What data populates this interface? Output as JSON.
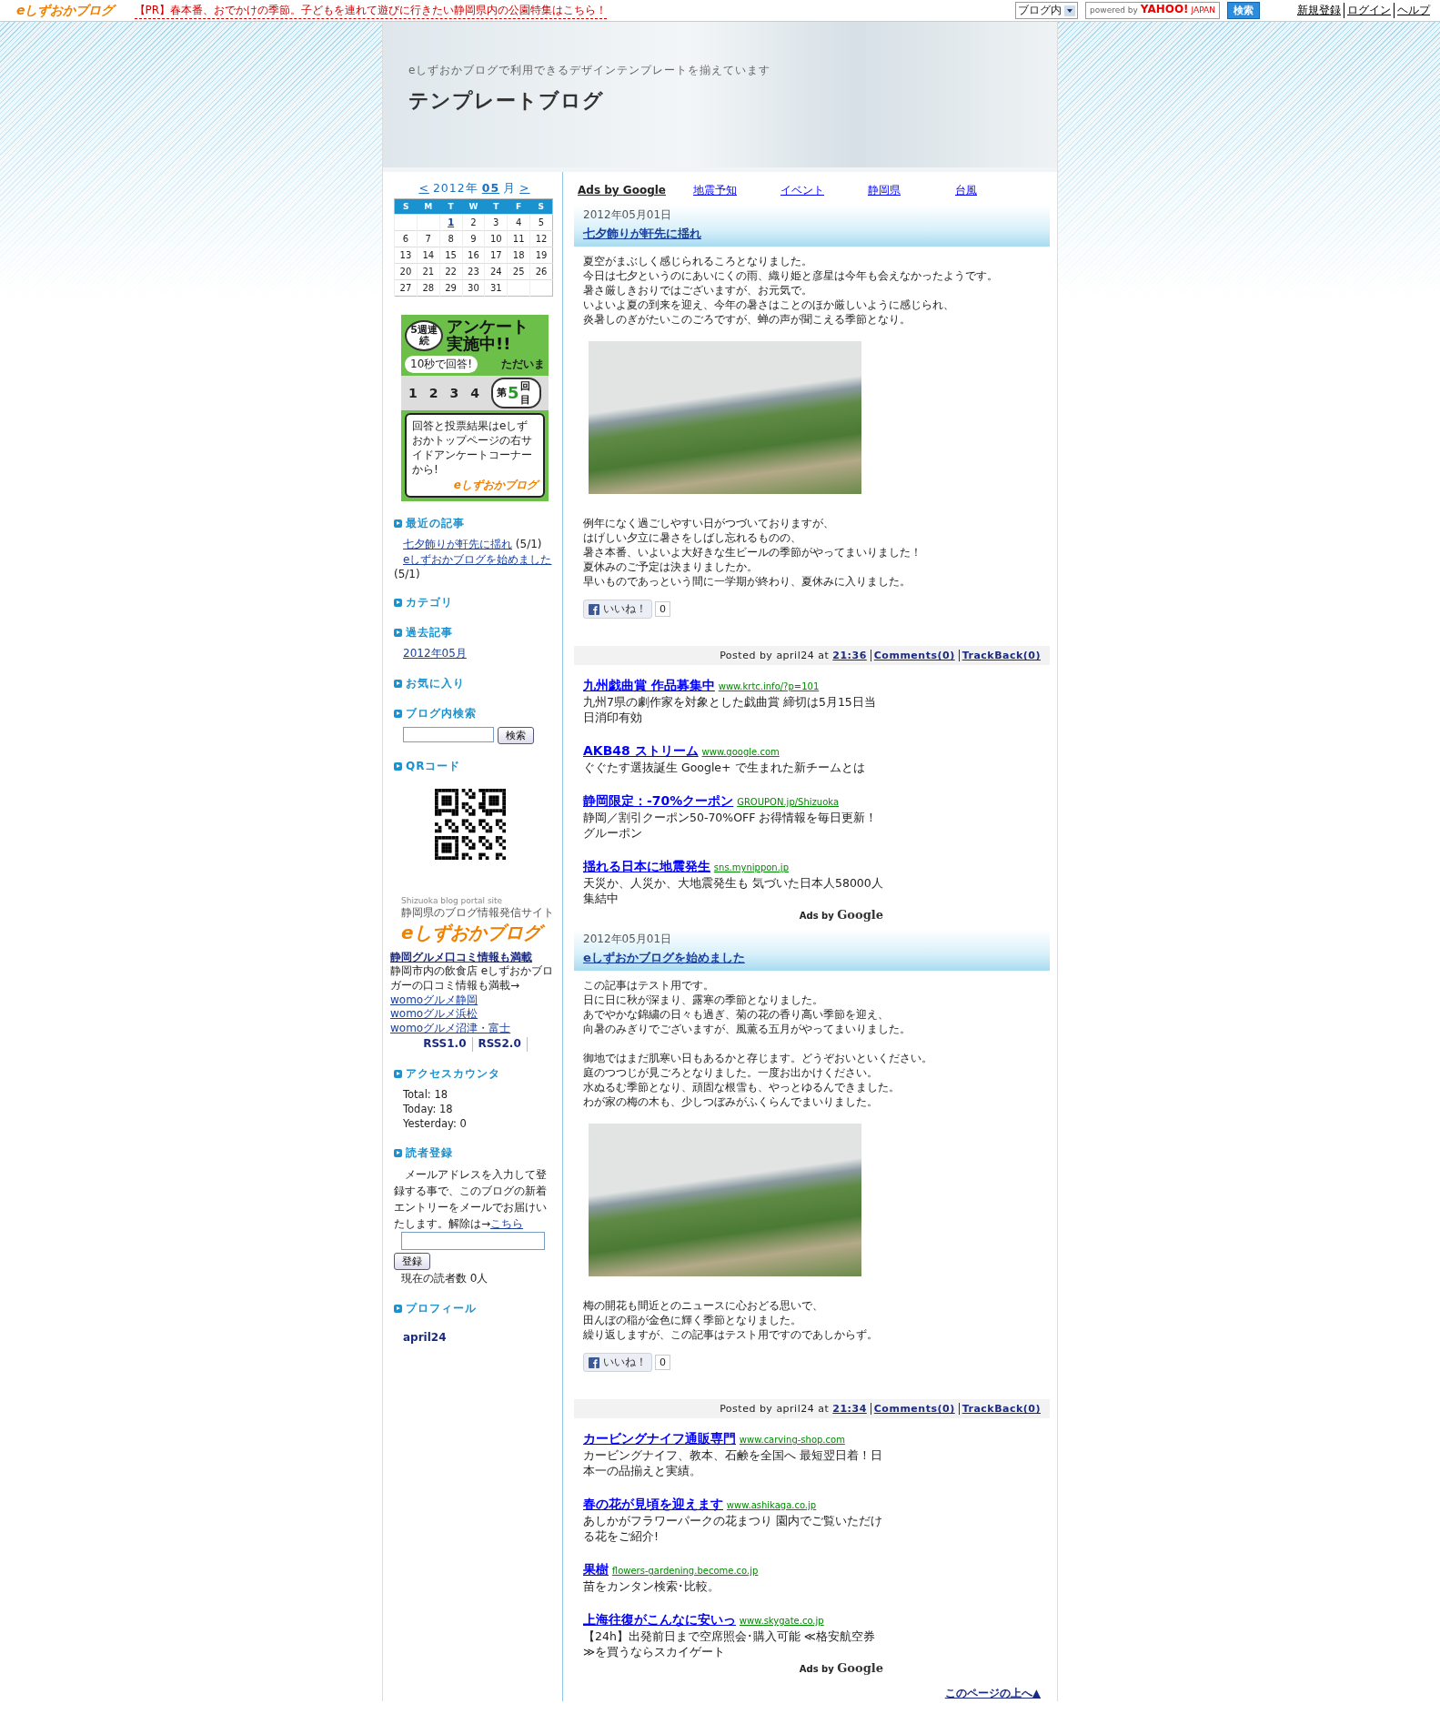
{
  "top_bar": {
    "logo": "eしずおかブログ",
    "pr_text": "【PR】春本番、おでかけの季節。子どもを連れて遊びに行きたい静岡県内の公園特集はこちら！",
    "search_scope": "ブログ内",
    "powered_by": "powered by",
    "yahoo": "YAHOO!",
    "yahoo_sub": "JAPAN",
    "search_button": "検索",
    "links": [
      "新規登録",
      "ログイン",
      "ヘルプ"
    ]
  },
  "header": {
    "tagline": "eしずおかブログで利用できるデザインテンプレートを揃えています",
    "title": "テンプレートブログ"
  },
  "calendar": {
    "prev": "<",
    "year": "2012年",
    "month": "05",
    "month_suffix": "月",
    "next": ">",
    "weekdays": [
      "S",
      "M",
      "T",
      "W",
      "T",
      "F",
      "S"
    ],
    "weeks": [
      [
        {
          "kind": "blank"
        },
        {
          "kind": "blank"
        },
        {
          "kind": "day",
          "day": "1",
          "linked": true
        },
        {
          "kind": "day",
          "day": "2",
          "linked": false
        },
        {
          "kind": "day",
          "day": "3",
          "linked": false
        },
        {
          "kind": "day",
          "day": "4",
          "linked": false
        },
        {
          "kind": "day",
          "day": "5",
          "linked": false
        }
      ],
      [
        {
          "kind": "day",
          "day": "6",
          "linked": false
        },
        {
          "kind": "day",
          "day": "7",
          "linked": false
        },
        {
          "kind": "day",
          "day": "8",
          "linked": false
        },
        {
          "kind": "day",
          "day": "9",
          "linked": false
        },
        {
          "kind": "day",
          "day": "10",
          "linked": false
        },
        {
          "kind": "day",
          "day": "11",
          "linked": false
        },
        {
          "kind": "day",
          "day": "12",
          "linked": false
        }
      ],
      [
        {
          "kind": "day",
          "day": "13",
          "linked": false
        },
        {
          "kind": "day",
          "day": "14",
          "linked": false
        },
        {
          "kind": "day",
          "day": "15",
          "linked": false
        },
        {
          "kind": "day",
          "day": "16",
          "linked": false
        },
        {
          "kind": "day",
          "day": "17",
          "linked": false
        },
        {
          "kind": "day",
          "day": "18",
          "linked": false
        },
        {
          "kind": "day",
          "day": "19",
          "linked": false
        }
      ],
      [
        {
          "kind": "day",
          "day": "20",
          "linked": false
        },
        {
          "kind": "day",
          "day": "21",
          "linked": false
        },
        {
          "kind": "day",
          "day": "22",
          "linked": false
        },
        {
          "kind": "day",
          "day": "23",
          "linked": false
        },
        {
          "kind": "day",
          "day": "24",
          "linked": false
        },
        {
          "kind": "day",
          "day": "25",
          "linked": false
        },
        {
          "kind": "day",
          "day": "26",
          "linked": false
        }
      ],
      [
        {
          "kind": "day",
          "day": "27",
          "linked": false
        },
        {
          "kind": "day",
          "day": "28",
          "linked": false
        },
        {
          "kind": "day",
          "day": "29",
          "linked": false
        },
        {
          "kind": "day",
          "day": "30",
          "linked": false
        },
        {
          "kind": "day",
          "day": "31",
          "linked": false
        },
        {
          "kind": "blank"
        },
        {
          "kind": "blank"
        }
      ]
    ]
  },
  "survey_banner": {
    "weeks_badge": "5週連続",
    "headline": "アンケート実施中!!",
    "pill": "10秒で回答!",
    "now": "ただいま",
    "numbers": [
      "1",
      "2",
      "3",
      "4"
    ],
    "ordinal_prefix": "第",
    "current": "5",
    "ordinal_suffix": "回目",
    "message": "回答と投票結果はeしずおかトップページの右サイドアンケートコーナーから!",
    "logo": "eしずおかブログ"
  },
  "recent": {
    "title": "最近の記事",
    "items": [
      {
        "label": "七夕飾りが軒先に揺れ",
        "date": "(5/1)"
      },
      {
        "label": "eしずおかブログを始めました",
        "date": "(5/1)"
      }
    ]
  },
  "category": {
    "title": "カテゴリ"
  },
  "archive": {
    "title": "過去記事",
    "items": [
      "2012年05月"
    ]
  },
  "favorites": {
    "title": "お気に入り"
  },
  "blog_search": {
    "title": "ブログ内検索",
    "button": "検索"
  },
  "qr": {
    "title": "QRコード"
  },
  "portal": {
    "caption": "Shizuoka blog portal site",
    "subtitle": "静岡県のブログ情報発信サイト",
    "logo": "eしずおかブログ",
    "gourmet_title": "静岡グルメ口コミ情報も満載",
    "gourmet_text": "静岡市内の飲食店 eしずおかブロガーの口コミ情報も満載→",
    "links": [
      "womoグルメ静岡",
      "womoグルメ浜松",
      "womoグルメ沼津・富士"
    ],
    "rss": [
      "RSS1.0",
      "RSS2.0"
    ]
  },
  "counter": {
    "title": "アクセスカウンタ",
    "lines": [
      "Total: 18",
      "Today: 18",
      "Yesterday: 0"
    ]
  },
  "subscribe": {
    "title": "読者登録",
    "text": "メールアドレスを入力して登録する事で、このブログの新着エントリーをメールでお届けいたします。解除は→",
    "link": "こちら",
    "button": "登録",
    "count": "現在の読者数 0人"
  },
  "profile": {
    "title": "プロフィール",
    "name": "april24"
  },
  "ad_links": {
    "label": "Ads by Google",
    "links": [
      "地震予知",
      "イベント",
      "静岡県",
      "台風"
    ]
  },
  "posts": [
    {
      "date": "2012年05月01日",
      "title": "七夕飾りが軒先に揺れ",
      "body": [
        {
          "kind": "text",
          "lines": [
            "夏空がまぶしく感じられるころとなりました。",
            "今日は七夕というのにあいにくの雨、織り姫と彦星は今年も会えなかったようです。",
            "暑さ厳しきおりではございますが、お元気で。",
            "いよいよ夏の到来を迎え、今年の暑さはことのほか厳しいように感じられ、",
            "炎暑しのぎがたいこのごろですが、蝉の声が聞こえる季節となり。"
          ]
        },
        {
          "kind": "photo"
        },
        {
          "kind": "text",
          "lines": [
            "例年になく過ごしやすい日がつづいておりますが、",
            "はげしい夕立に暑さをしばし忘れるものの、",
            "暑さ本番、いよいよ大好きな生ビールの季節がやってまいりました！",
            "夏休みのご予定は決まりましたか。",
            "早いものであっという間に一学期が終わり、夏休みに入りました。"
          ]
        }
      ],
      "like": "いいね！",
      "like_count": "0",
      "posted_by": "Posted by april24 at",
      "time": "21:36",
      "comments": "Comments(0)",
      "trackback": "TrackBack(0)",
      "ads": [
        {
          "title": "九州戯曲賞 作品募集中",
          "url": "www.krtc.info/?p=101",
          "desc": "九州7県の劇作家を対象とした戯曲賞 締切は5月15日当日消印有効"
        },
        {
          "title": "AKB48 ストリーム",
          "url": "www.google.com",
          "desc": "ぐぐたす選抜誕生 Google+ で生まれた新チームとは"
        },
        {
          "title": "静岡限定：-70%クーポン",
          "url": "GROUPON.jp/Shizuoka",
          "desc": "静岡／割引クーポン50-70%OFF お得情報を毎日更新！グルーポン"
        },
        {
          "title": "揺れる日本に地震発生",
          "url": "sns.mynippon.jp",
          "desc": "天災か、人災か、大地震発生も 気づいた日本人58000人集結中"
        }
      ],
      "ads_label": "Ads by",
      "ads_brand": "Google"
    },
    {
      "date": "2012年05月01日",
      "title": "eしずおかブログを始めました",
      "body": [
        {
          "kind": "text",
          "lines": [
            "この記事はテスト用です。",
            "日に日に秋が深まり、露寒の季節となりました。",
            "あでやかな錦繍の日々も過ぎ、菊の花の香り高い季節を迎え、",
            "向暑のみぎりでございますが、風薫る五月がやってまいりました。"
          ]
        },
        {
          "kind": "text",
          "lines": [
            "御地ではまだ肌寒い日もあるかと存じます。どうぞおいといください。",
            "庭のつつじが見ごろとなりました。一度お出かけください。",
            "水ぬるむ季節となり、頑固な根雪も、やっとゆるんできました。",
            "わが家の梅の木も、少しつぼみがふくらんでまいりました。"
          ]
        },
        {
          "kind": "photo"
        },
        {
          "kind": "text",
          "lines": [
            "梅の開花も間近とのニュースに心おどる思いで、",
            "田んぼの稲が金色に輝く季節となりました。",
            "繰り返しますが、この記事はテスト用ですのであしからず。"
          ]
        }
      ],
      "like": "いいね！",
      "like_count": "0",
      "posted_by": "Posted by april24 at",
      "time": "21:34",
      "comments": "Comments(0)",
      "trackback": "TrackBack(0)",
      "ads": [
        {
          "title": "カービングナイフ通販専門",
          "url": "www.carving-shop.com",
          "desc": "カービングナイフ、教本、石鹸を全国へ 最短翌日着！日本一の品揃えと実績。"
        },
        {
          "title": "春の花が見頃を迎えます",
          "url": "www.ashikaga.co.jp",
          "desc": "あしかがフラワーパークの花まつり 園内でご覧いただける花をご紹介!"
        },
        {
          "title": "果樹",
          "url": "flowers-gardening.become.co.jp",
          "desc": "苗をカンタン検索･比較。"
        },
        {
          "title": "上海往復がこんなに安いっ",
          "url": "www.skygate.co.jp",
          "desc": "【24h】出発前日まで空席照会･購入可能 ≪格安航空券≫を買うならスカイゲート"
        }
      ],
      "ads_label": "Ads by",
      "ads_brand": "Google"
    }
  ],
  "page_top": "このページの上へ▲"
}
